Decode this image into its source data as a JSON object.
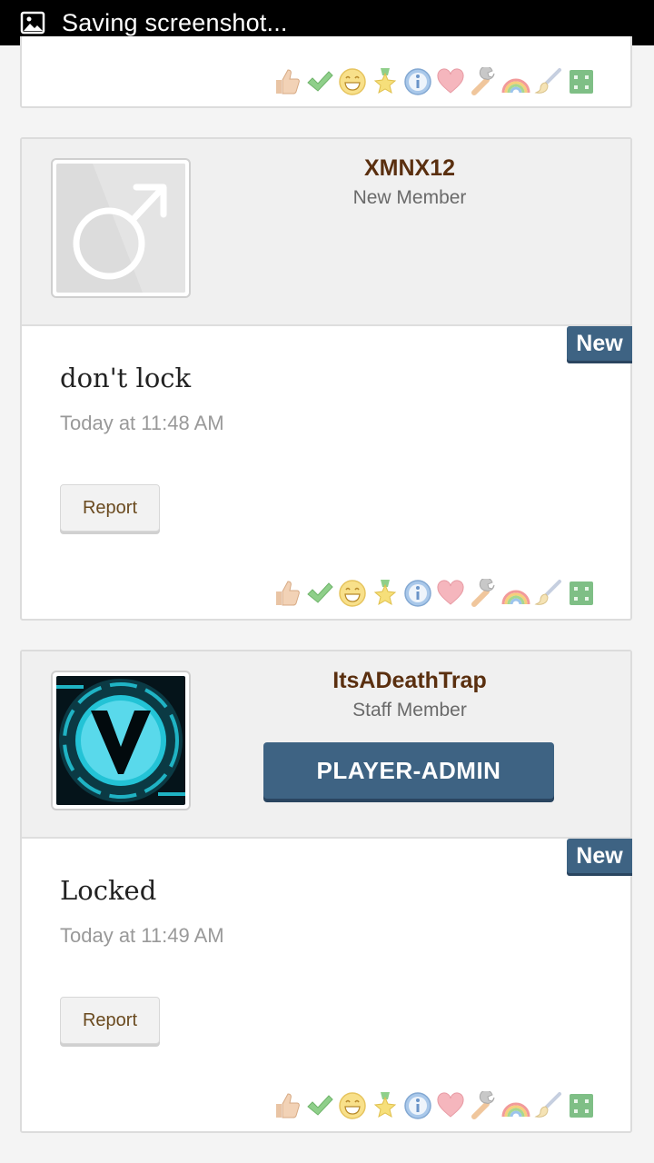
{
  "status_bar": {
    "text": "Saving screenshot..."
  },
  "reactions": [
    "like-icon",
    "agree-icon",
    "funny-icon",
    "winner-icon",
    "informative-icon",
    "love-icon",
    "useful-icon",
    "creative-icon",
    "artistic-icon",
    "friendly-icon"
  ],
  "posts": [
    {
      "username": "XMNX12",
      "user_title": "New Member",
      "badge": "New",
      "message": "don't lock",
      "timestamp": "Today at 11:48 AM",
      "report_label": "Report"
    },
    {
      "username": "ItsADeathTrap",
      "user_title": "Staff Member",
      "banner": "PLAYER-ADMIN",
      "badge": "New",
      "message": "Locked",
      "timestamp": "Today at 11:49 AM",
      "report_label": "Report"
    }
  ],
  "colors": {
    "username": "#5a2f0f",
    "accent": "#3e6383"
  }
}
